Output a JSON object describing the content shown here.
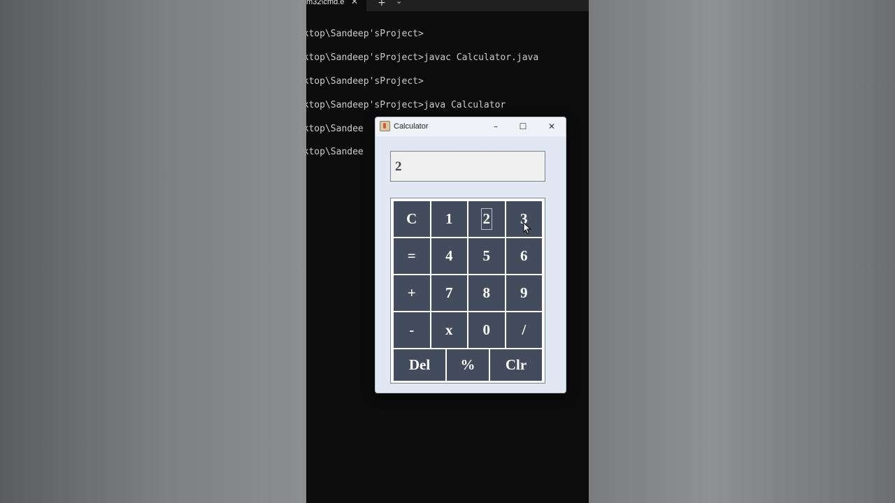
{
  "terminal": {
    "tab_title": "m32\\cmd.e",
    "tab_close": "✕",
    "tab_new": "+",
    "tab_dropdown": "⌄",
    "lines": [
      "esktop\\Sandeep'sProject>",
      "esktop\\Sandeep'sProject>javac Calculator.java",
      "esktop\\Sandeep'sProject>",
      "esktop\\Sandeep'sProject>java Calculator",
      "esktop\\Sandee",
      "esktop\\Sandee"
    ]
  },
  "calculator": {
    "title": "Calculator",
    "minimize": "–",
    "maximize": "☐",
    "close": "✕",
    "display_value": "2",
    "keys": [
      "C",
      "1",
      "2",
      "3",
      "=",
      "4",
      "5",
      "6",
      "+",
      "7",
      "8",
      "9",
      "-",
      "x",
      "0",
      "/"
    ],
    "bottom_keys": [
      "Del",
      "%",
      "Clr"
    ],
    "focused_key": "2"
  },
  "colors": {
    "key_bg": "#434c5d",
    "window_bg": "#dfe8f3",
    "terminal_bg": "#0c0c0c"
  }
}
